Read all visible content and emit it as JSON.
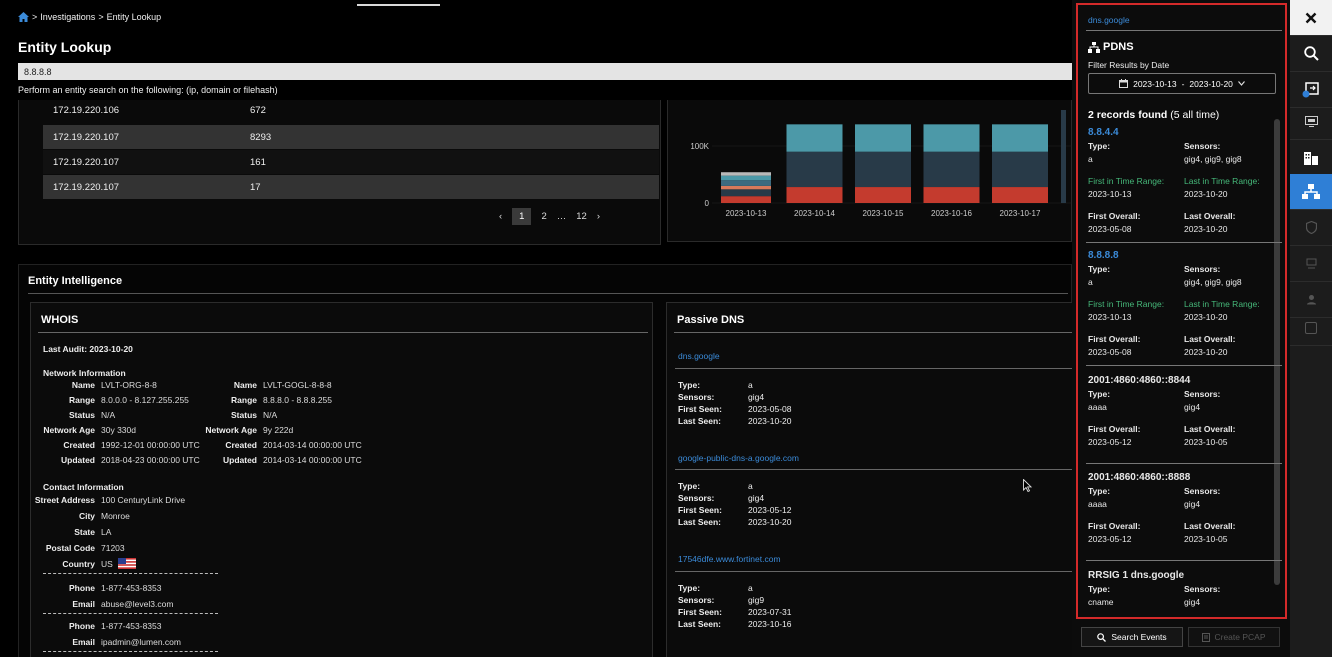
{
  "breadcrumb": {
    "sep": ">",
    "items": [
      "Investigations",
      "Entity Lookup"
    ]
  },
  "page_title": "Entity Lookup",
  "search": {
    "value": "8.8.8.8",
    "help": "Perform an entity search on the following: (ip, domain or filehash)"
  },
  "top_table": {
    "partial_row": {
      "ip": "172.19.220.106",
      "count": "672"
    },
    "rows": [
      {
        "ip": "172.19.220.107",
        "count": "8293"
      },
      {
        "ip": "172.19.220.107",
        "count": "161"
      },
      {
        "ip": "172.19.220.107",
        "count": "17"
      }
    ],
    "pager": {
      "prev": "‹",
      "current": "1",
      "next_page": "2",
      "ellipsis": "…",
      "last": "12",
      "next": "›"
    }
  },
  "chart_data": {
    "type": "bar",
    "stacked": true,
    "categories": [
      "2023-10-13",
      "2023-10-14",
      "2023-10-15",
      "2023-10-16",
      "2023-10-17"
    ],
    "y_ticks": [
      "0",
      "100K"
    ],
    "ylim": [
      0,
      200000
    ],
    "series": [
      {
        "color": "#c43b2e",
        "values": [
          12000,
          28000,
          28000,
          28000,
          28000
        ]
      },
      {
        "color": "#283a48",
        "values": [
          12000,
          62000,
          62000,
          62000,
          62000
        ]
      },
      {
        "color": "#d97a5b",
        "values": [
          6000,
          0,
          0,
          0,
          0
        ]
      },
      {
        "color": "#3d6b80",
        "values": [
          10000,
          0,
          0,
          0,
          0
        ]
      },
      {
        "color": "#4c99a8",
        "values": [
          8000,
          48000,
          48000,
          48000,
          48000
        ]
      },
      {
        "color": "#b9b9b9",
        "values": [
          6000,
          0,
          0,
          0,
          0
        ]
      }
    ]
  },
  "entity_intel": {
    "title": "Entity Intelligence"
  },
  "whois": {
    "title": "WHOIS",
    "last_audit": "Last Audit: 2023-10-20",
    "network_header": "Network Information",
    "left": [
      {
        "k": "Name",
        "v": "LVLT-ORG-8-8"
      },
      {
        "k": "Range",
        "v": "8.0.0.0 - 8.127.255.255"
      },
      {
        "k": "Status",
        "v": "N/A"
      },
      {
        "k": "Network Age",
        "v": "30y 330d"
      },
      {
        "k": "Created",
        "v": "1992-12-01 00:00:00 UTC"
      },
      {
        "k": "Updated",
        "v": "2018-04-23 00:00:00 UTC"
      }
    ],
    "right": [
      {
        "k": "Name",
        "v": "LVLT-GOGL-8-8-8"
      },
      {
        "k": "Range",
        "v": "8.8.8.0 - 8.8.8.255"
      },
      {
        "k": "Status",
        "v": "N/A"
      },
      {
        "k": "Network Age",
        "v": "9y 222d"
      },
      {
        "k": "Created",
        "v": "2014-03-14 00:00:00 UTC"
      },
      {
        "k": "Updated",
        "v": "2014-03-14 00:00:00 UTC"
      }
    ],
    "contact_header": "Contact Information",
    "contact": [
      {
        "k": "Street Address",
        "v": "100 CenturyLink Drive"
      },
      {
        "k": "City",
        "v": "Monroe"
      },
      {
        "k": "State",
        "v": "LA"
      },
      {
        "k": "Postal Code",
        "v": "71203"
      },
      {
        "k": "Country",
        "v": "US"
      }
    ],
    "contacts2": [
      {
        "k": "Phone",
        "v": "1-877-453-8353"
      },
      {
        "k": "Email",
        "v": "abuse@level3.com"
      }
    ],
    "contacts3": [
      {
        "k": "Phone",
        "v": "1-877-453-8353"
      },
      {
        "k": "Email",
        "v": "ipadmin@lumen.com"
      }
    ]
  },
  "passive_dns": {
    "title": "Passive DNS",
    "labels": {
      "type": "Type:",
      "sensors": "Sensors:",
      "first": "First Seen:",
      "last": "Last Seen:"
    },
    "entries": [
      {
        "domain": "dns.google",
        "type": "a",
        "sensors": "gig4",
        "first": "2023-05-08",
        "last": "2023-10-20"
      },
      {
        "domain": "google-public-dns-a.google.com",
        "type": "a",
        "sensors": "gig4",
        "first": "2023-05-12",
        "last": "2023-10-20"
      },
      {
        "domain": "17546dfe.www.fortinet.com",
        "type": "a",
        "sensors": "gig9",
        "first": "2023-07-31",
        "last": "2023-10-16"
      }
    ]
  },
  "panel": {
    "domain": "dns.google",
    "title": "PDNS",
    "filter_label": "Filter Results by Date",
    "date_from": "2023-10-13",
    "date_sep": "-",
    "date_to": "2023-10-20",
    "count_main": "2 records found",
    "count_sub": "(5 all time)",
    "labels": {
      "type": "Type:",
      "sensors": "Sensors:",
      "first_range": "First in Time Range:",
      "last_range": "Last in Time Range:",
      "first_overall": "First Overall:",
      "last_overall": "Last Overall:"
    },
    "records": [
      {
        "ip": "8.8.4.4",
        "type": "a",
        "sensors": "gig4, gig9, gig8",
        "first_range": "2023-10-13",
        "last_range": "2023-10-20",
        "first_overall": "2023-05-08",
        "last_overall": "2023-10-20"
      },
      {
        "ip": "8.8.8.8",
        "type": "a",
        "sensors": "gig4, gig9, gig8",
        "first_range": "2023-10-13",
        "last_range": "2023-10-20",
        "first_overall": "2023-05-08",
        "last_overall": "2023-10-20"
      },
      {
        "ip": "2001:4860:4860::8844",
        "type": "aaaa",
        "sensors": "gig4",
        "first_overall": "2023-05-12",
        "last_overall": "2023-10-05"
      },
      {
        "ip": "2001:4860:4860::8888",
        "type": "aaaa",
        "sensors": "gig4",
        "first_overall": "2023-05-12",
        "last_overall": "2023-10-05"
      },
      {
        "ip": "RRSIG 1 dns.google",
        "type": "cname",
        "sensors": "gig4"
      }
    ],
    "search_events": "Search Events",
    "create_pcap": "Create PCAP"
  },
  "rail": [
    "close-icon",
    "search-icon",
    "monitor-arrow-icon",
    "screen-icon",
    "building-icon",
    "network-icon",
    "shield-icon",
    "terminal-icon",
    "user-icon",
    "square-icon"
  ],
  "colors": {
    "accent": "#2f7fd6",
    "link": "#3b8bd9",
    "highlight_border": "#d42a2a",
    "range_green": "#46b97a"
  }
}
